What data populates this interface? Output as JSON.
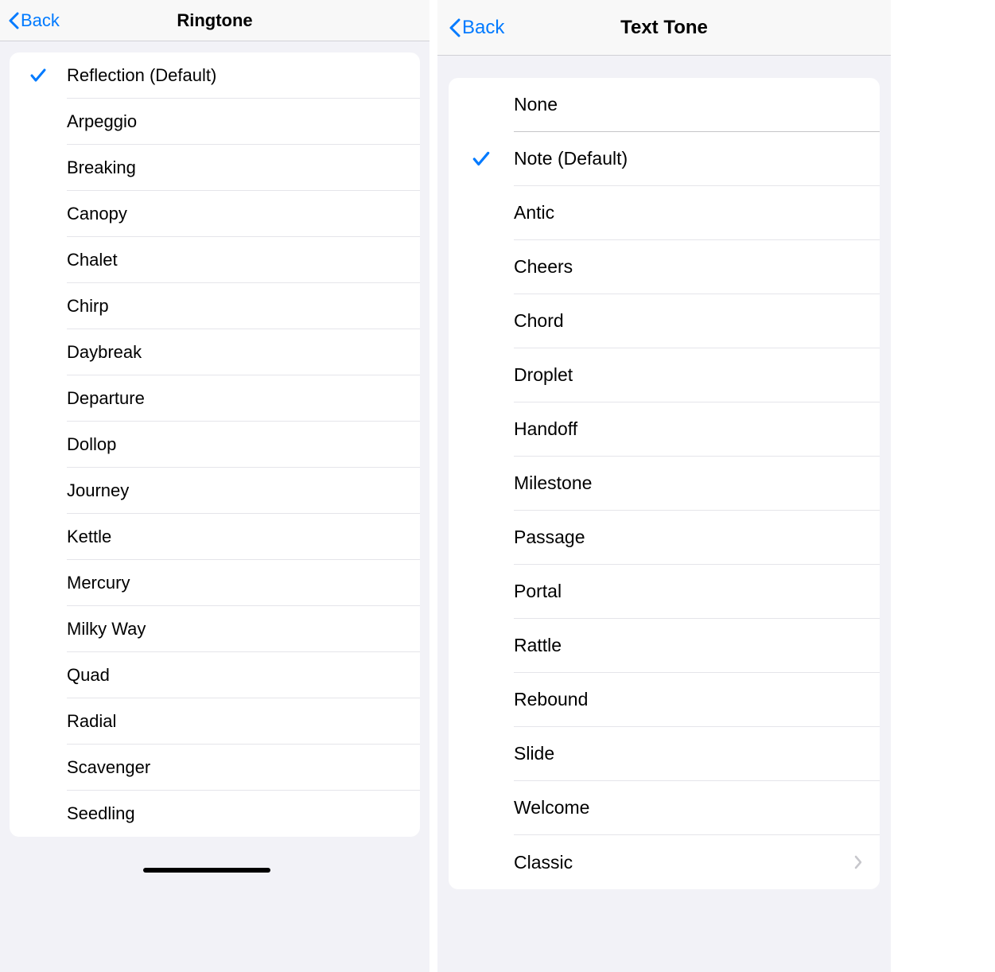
{
  "left": {
    "back_label": "Back",
    "title": "Ringtone",
    "items": [
      {
        "label": "Reflection (Default)",
        "selected": true
      },
      {
        "label": "Arpeggio",
        "selected": false
      },
      {
        "label": "Breaking",
        "selected": false
      },
      {
        "label": "Canopy",
        "selected": false
      },
      {
        "label": "Chalet",
        "selected": false
      },
      {
        "label": "Chirp",
        "selected": false
      },
      {
        "label": "Daybreak",
        "selected": false
      },
      {
        "label": "Departure",
        "selected": false
      },
      {
        "label": "Dollop",
        "selected": false
      },
      {
        "label": "Journey",
        "selected": false
      },
      {
        "label": "Kettle",
        "selected": false
      },
      {
        "label": "Mercury",
        "selected": false
      },
      {
        "label": "Milky Way",
        "selected": false
      },
      {
        "label": "Quad",
        "selected": false
      },
      {
        "label": "Radial",
        "selected": false
      },
      {
        "label": "Scavenger",
        "selected": false
      },
      {
        "label": "Seedling",
        "selected": false
      }
    ]
  },
  "right": {
    "back_label": "Back",
    "title": "Text Tone",
    "separated_item": {
      "label": "None",
      "selected": false
    },
    "items": [
      {
        "label": "Note (Default)",
        "selected": true
      },
      {
        "label": "Antic",
        "selected": false
      },
      {
        "label": "Cheers",
        "selected": false
      },
      {
        "label": "Chord",
        "selected": false
      },
      {
        "label": "Droplet",
        "selected": false
      },
      {
        "label": "Handoff",
        "selected": false
      },
      {
        "label": "Milestone",
        "selected": false
      },
      {
        "label": "Passage",
        "selected": false
      },
      {
        "label": "Portal",
        "selected": false
      },
      {
        "label": "Rattle",
        "selected": false
      },
      {
        "label": "Rebound",
        "selected": false
      },
      {
        "label": "Slide",
        "selected": false
      },
      {
        "label": "Welcome",
        "selected": false
      },
      {
        "label": "Classic",
        "selected": false,
        "disclosure": true
      }
    ]
  }
}
